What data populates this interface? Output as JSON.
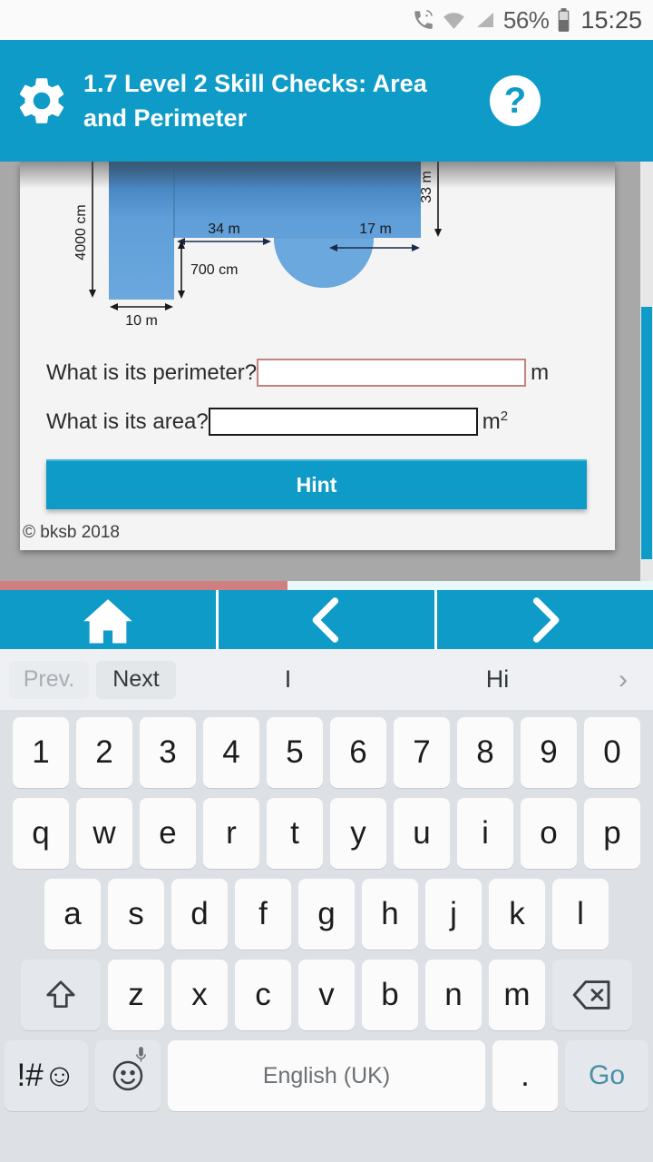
{
  "status_bar": {
    "icons": [
      "wifi-calling-icon",
      "wifi-icon",
      "signal-icon",
      "battery-icon"
    ],
    "battery_percent": "56%",
    "time": "15:25"
  },
  "app_bar": {
    "settings_icon": "gear-icon",
    "title": "1.7 Level 2 Skill Checks: Area and Perimeter",
    "help_icon": "question-mark-icon",
    "help_label": "?",
    "background_color": "#0e9bc8"
  },
  "diagram": {
    "shape": "compound L-shape with semicircular cut-out",
    "fill_color": "#6aa8de",
    "labels": {
      "left_height": "4000 cm",
      "top_width": "34 m",
      "semicircle_diameter": "17 m",
      "right_height": "33 m",
      "notch_height": "700 cm",
      "bottom_width": "10 m"
    }
  },
  "questions": [
    {
      "label": "What is its perimeter?",
      "value": "",
      "placeholder": "",
      "unit": "m",
      "unit_exponent": "",
      "border_color": "#c4847e",
      "focused": true
    },
    {
      "label": "What is its area?",
      "value": "",
      "placeholder": "",
      "unit": "m",
      "unit_exponent": "2",
      "border_color": "#1a1a1a",
      "focused": false
    }
  ],
  "hint_button": {
    "label": "Hint"
  },
  "copyright": "© bksb 2018",
  "progress": {
    "percent": 44,
    "color": "#cf7f7f"
  },
  "nav_bar": {
    "buttons": [
      {
        "name": "home",
        "icon": "home-icon"
      },
      {
        "name": "previous",
        "icon": "chevron-left-icon"
      },
      {
        "name": "next",
        "icon": "chevron-right-icon"
      }
    ]
  },
  "keyboard": {
    "suggestions": {
      "prev_label": "Prev.",
      "next_label": "Next",
      "words": [
        "I",
        "Hi"
      ],
      "more_icon": "chevron-right-icon"
    },
    "rows": {
      "numbers": [
        "1",
        "2",
        "3",
        "4",
        "5",
        "6",
        "7",
        "8",
        "9",
        "0"
      ],
      "top": [
        "q",
        "w",
        "e",
        "r",
        "t",
        "y",
        "u",
        "i",
        "o",
        "p"
      ],
      "home": [
        "a",
        "s",
        "d",
        "f",
        "g",
        "h",
        "j",
        "k",
        "l"
      ],
      "bottom": [
        "z",
        "x",
        "c",
        "v",
        "b",
        "n",
        "m"
      ]
    },
    "shift_icon": "shift-arrow-icon",
    "delete_icon": "backspace-icon",
    "symbols_label": "!#☺",
    "emoji_icon": "emoji-smiley-icon",
    "mic_icon": "microphone-icon",
    "space_label": "English (UK)",
    "period_label": ".",
    "go_label": "Go"
  }
}
